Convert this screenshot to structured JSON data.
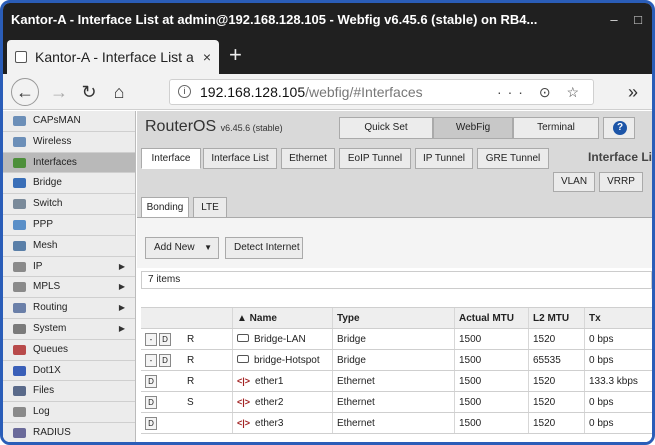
{
  "window": {
    "title": "Kantor-A - Interface List at admin@192.168.128.105 - Webfig v6.45.6 (stable) on RB4..."
  },
  "browser": {
    "tab_title": "Kantor-A - Interface List a",
    "tab_close": "×",
    "new_tab": "+",
    "url_host": "192.168.128.105",
    "url_path": "/webfig/#Interfaces",
    "url_actions": "··· ⊙ ☆",
    "extend": "»"
  },
  "sidebar": {
    "items": [
      {
        "label": "CAPsMAN",
        "arrow": "",
        "color": "#6c8fb8"
      },
      {
        "label": "Wireless",
        "arrow": "",
        "color": "#6c8fb8"
      },
      {
        "label": "Interfaces",
        "arrow": "",
        "color": "#4d8f3a",
        "active": true
      },
      {
        "label": "Bridge",
        "arrow": "",
        "color": "#3a6fb8"
      },
      {
        "label": "Switch",
        "arrow": "",
        "color": "#7a8a9a"
      },
      {
        "label": "PPP",
        "arrow": "",
        "color": "#5a8fc8"
      },
      {
        "label": "Mesh",
        "arrow": "",
        "color": "#5a7fa8"
      },
      {
        "label": "IP",
        "arrow": "▶",
        "color": "#8a8a8a"
      },
      {
        "label": "MPLS",
        "arrow": "▶",
        "color": "#8a8a8a"
      },
      {
        "label": "Routing",
        "arrow": "▶",
        "color": "#6a7fa8"
      },
      {
        "label": "System",
        "arrow": "▶",
        "color": "#7a7a7a"
      },
      {
        "label": "Queues",
        "arrow": "",
        "color": "#b84a4a"
      },
      {
        "label": "Dot1X",
        "arrow": "",
        "color": "#3a5fb8"
      },
      {
        "label": "Files",
        "arrow": "",
        "color": "#5a6a8a"
      },
      {
        "label": "Log",
        "arrow": "",
        "color": "#8a8a8a"
      },
      {
        "label": "RADIUS",
        "arrow": "",
        "color": "#6a6a9a"
      }
    ]
  },
  "header": {
    "product": "RouterOS",
    "version": "v6.45.6 (stable)",
    "buttons": {
      "quickset": "Quick Set",
      "webfig": "WebFig",
      "terminal": "Terminal",
      "help": "?"
    }
  },
  "tabs": {
    "items": [
      "Interface",
      "Interface List",
      "Ethernet",
      "EoIP Tunnel",
      "IP Tunnel",
      "GRE Tunnel"
    ],
    "section_title": "Interface List",
    "row2": [
      "VLAN",
      "VRRP"
    ],
    "row3": [
      "Bonding",
      "LTE"
    ]
  },
  "actions": {
    "add_new": "Add New",
    "add_caret": "▼",
    "detect": "Detect Internet"
  },
  "count_label": "7 items",
  "table": {
    "headers": [
      "",
      "",
      "▲ Name",
      "Type",
      "Actual MTU",
      "L2 MTU",
      "Tx"
    ],
    "rows": [
      {
        "btn1": "-",
        "btn2": "D",
        "flag": "R",
        "icon": "bridge",
        "name": "Bridge-LAN",
        "type": "Bridge",
        "mtu": "1500",
        "l2mtu": "1520",
        "tx": "0 bps"
      },
      {
        "btn1": "-",
        "btn2": "D",
        "flag": "R",
        "icon": "bridge",
        "name": "bridge-Hotspot",
        "type": "Bridge",
        "mtu": "1500",
        "l2mtu": "65535",
        "tx": "0 bps"
      },
      {
        "btn1": "",
        "btn2": "D",
        "flag": "R",
        "icon": "ether",
        "name": "ether1",
        "type": "Ethernet",
        "mtu": "1500",
        "l2mtu": "1520",
        "tx": "133.3 kbps"
      },
      {
        "btn1": "",
        "btn2": "D",
        "flag": "S",
        "icon": "ether",
        "name": "ether2",
        "type": "Ethernet",
        "mtu": "1500",
        "l2mtu": "1520",
        "tx": "0 bps"
      },
      {
        "btn1": "",
        "btn2": "D",
        "flag": "",
        "icon": "ether",
        "name": "ether3",
        "type": "Ethernet",
        "mtu": "1500",
        "l2mtu": "1520",
        "tx": "0 bps"
      }
    ]
  }
}
